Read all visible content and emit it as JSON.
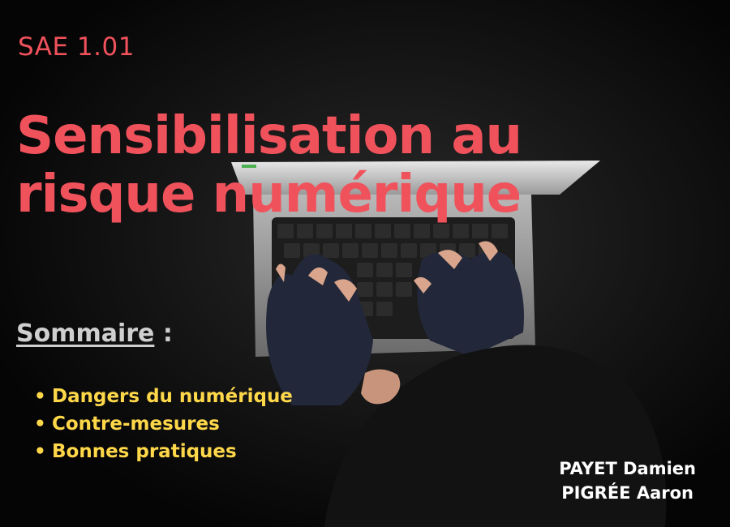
{
  "slide": {
    "course_code": "SAE 1.01",
    "title_line1": "Sensibilisation au",
    "title_line2": "risque numérique",
    "toc_heading": "Sommaire",
    "toc_colon": " :",
    "toc_items": [
      "Dangers du numérique",
      "Contre-mesures",
      "Bonnes pratiques"
    ],
    "authors": [
      "PAYET Damien",
      "PIGRÉE Aaron"
    ],
    "colors": {
      "title": "#f0525c",
      "toc_items": "#ffd84a",
      "toc_heading": "#cfcfcf",
      "authors": "#ffffff",
      "background": "#0a0a0a"
    },
    "background_image": "hacker-laptop-photo"
  }
}
